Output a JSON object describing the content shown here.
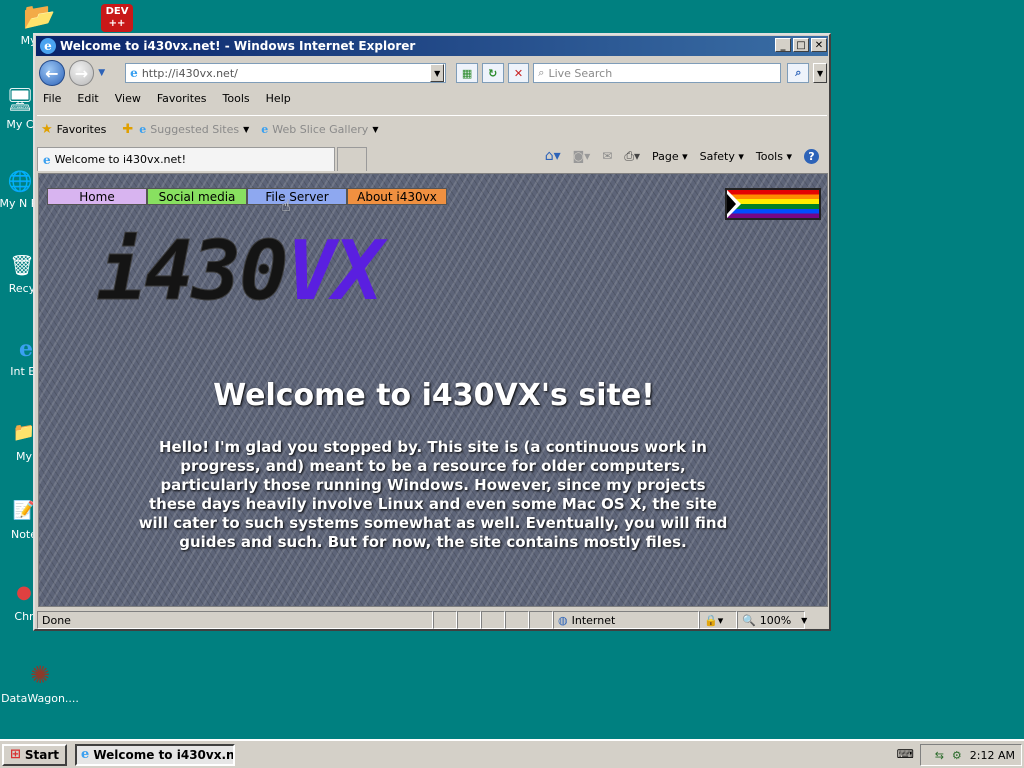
{
  "desktop": {
    "icons": [
      {
        "label": "My Do",
        "glyph": "📂"
      },
      {
        "label": "My C",
        "glyph": "🖥"
      },
      {
        "label": "My N Pl",
        "glyph": "🌐"
      },
      {
        "label": "Recy",
        "glyph": "🗑"
      },
      {
        "label": "Int Ex",
        "glyph": "e"
      },
      {
        "label": "My",
        "glyph": "📁"
      },
      {
        "label": "Note",
        "glyph": "📝"
      },
      {
        "label": "Chr",
        "glyph": "●"
      },
      {
        "label": "DataWagon....",
        "glyph": "✺"
      }
    ],
    "dev_icon": {
      "line1": "DEV",
      "line2": "++"
    }
  },
  "window": {
    "title": "Welcome to i430vx.net! - Windows Internet Explorer"
  },
  "addressbar": {
    "url": "http://i430vx.net/",
    "search_placeholder": "Live Search"
  },
  "menu": [
    "File",
    "Edit",
    "View",
    "Favorites",
    "Tools",
    "Help"
  ],
  "favbar": {
    "favorites": "Favorites",
    "suggested": "Suggested Sites",
    "webslice": "Web Slice Gallery"
  },
  "tab": {
    "title": "Welcome to i430vx.net!"
  },
  "commandbar": {
    "page": "Page",
    "safety": "Safety",
    "tools": "Tools"
  },
  "page": {
    "nav": [
      {
        "label": "Home",
        "color": "#d8b4f0"
      },
      {
        "label": "Social media",
        "color": "#88e060"
      },
      {
        "label": "File Server",
        "color": "#8ea8f0"
      },
      {
        "label": "About i430vx",
        "color": "#f09040"
      }
    ],
    "logo": {
      "part1": "i430",
      "part2": "VX"
    },
    "heading": "Welcome to i430VX's site!",
    "intro": "Hello! I'm glad you stopped by. This site is (a continuous work in progress, and) meant to be a resource for older computers, particularly those running Windows. However, since my projects these days heavily involve Linux and even some Mac OS X, the site will cater to such systems somewhat as well. Eventually, you will find guides and such. But for now, the site contains mostly files."
  },
  "status": {
    "text": "Done",
    "zone": "Internet",
    "zoom": "100%"
  },
  "taskbar": {
    "start": "Start",
    "button": "Welcome to i430vx.n...",
    "clock": "2:12 AM"
  }
}
